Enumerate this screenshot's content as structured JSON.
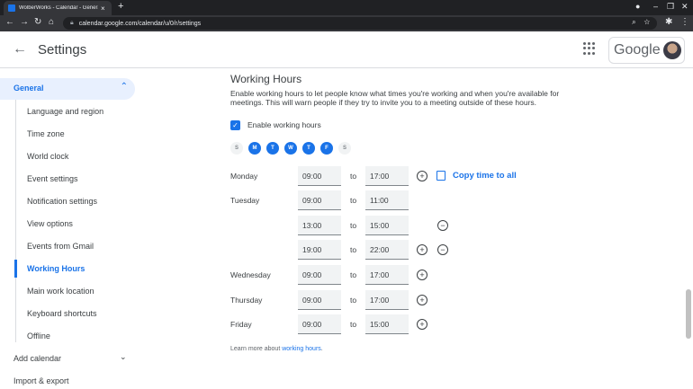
{
  "browser": {
    "tab_title": "WolberWorks - Calendar - General",
    "tab_close": "×",
    "new_tab": "+",
    "url": "calendar.google.com/calendar/u/0/r/settings"
  },
  "header": {
    "title": "Settings",
    "logo": "Google"
  },
  "sidebar": {
    "general": "General",
    "items": [
      {
        "label": "Language and region"
      },
      {
        "label": "Time zone"
      },
      {
        "label": "World clock"
      },
      {
        "label": "Event settings"
      },
      {
        "label": "Notification settings"
      },
      {
        "label": "View options"
      },
      {
        "label": "Events from Gmail"
      },
      {
        "label": "Working Hours"
      },
      {
        "label": "Main work location"
      },
      {
        "label": "Keyboard shortcuts"
      },
      {
        "label": "Offline"
      }
    ],
    "add_calendar": "Add calendar",
    "import_export": "Import & export"
  },
  "working_hours": {
    "title": "Working Hours",
    "description": "Enable working hours to let people know what times you're working and when you're available for meetings. This will warn people if they try to invite you to a meeting outside of these hours.",
    "enable_label": "Enable working hours",
    "checkbox_mark": "✓",
    "days": [
      "S",
      "M",
      "T",
      "W",
      "T",
      "F",
      "S"
    ],
    "to_label": "to",
    "copy_label": "Copy time to all",
    "rows": [
      {
        "day": "Monday",
        "start": "09:00",
        "end": "17:00"
      },
      {
        "day": "Tuesday",
        "start": "09:00",
        "end": "11:00"
      },
      {
        "day": "",
        "start": "13:00",
        "end": "15:00"
      },
      {
        "day": "",
        "start": "19:00",
        "end": "22:00"
      },
      {
        "day": "Wednesday",
        "start": "09:00",
        "end": "17:00"
      },
      {
        "day": "Thursday",
        "start": "09:00",
        "end": "17:00"
      },
      {
        "day": "Friday",
        "start": "09:00",
        "end": "15:00"
      }
    ],
    "learn_more_prefix": "Learn more about ",
    "learn_more_link": "working hours",
    "learn_more_suffix": "."
  },
  "colors": {
    "accent": "#1a73e8",
    "selected_bg": "#e8f0fe"
  }
}
